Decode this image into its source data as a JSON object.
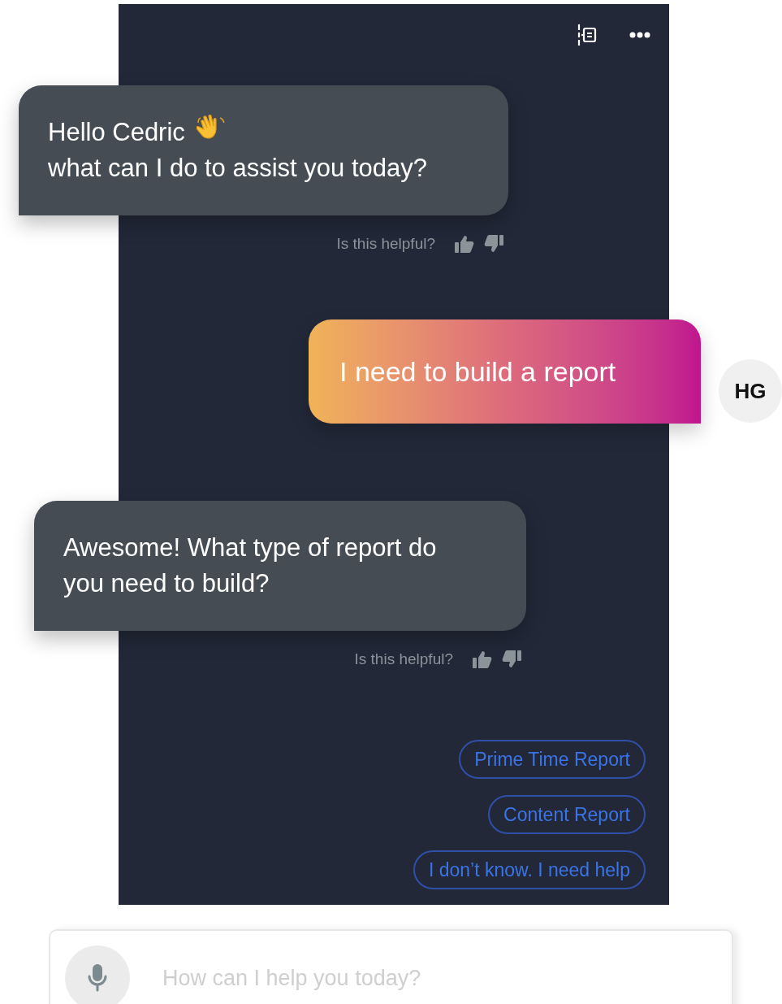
{
  "messages": [
    {
      "kind": "bot",
      "wave": true,
      "lines": [
        "Hello Cedric",
        "what can I do to assist you today?"
      ],
      "feedback": "Is this helpful?"
    },
    {
      "kind": "user",
      "wave": false,
      "lines": [
        "I need to build a report"
      ],
      "avatar": "HG"
    },
    {
      "kind": "bot",
      "wave": false,
      "lines": [
        "Awesome! What type of report do you need to build?"
      ],
      "feedback": "Is this helpful?"
    }
  ],
  "quick_replies": [
    "Prime Time Report",
    "Content Report",
    "I don’t know. I need help"
  ],
  "input": {
    "placeholder": "How can I help you today?"
  }
}
